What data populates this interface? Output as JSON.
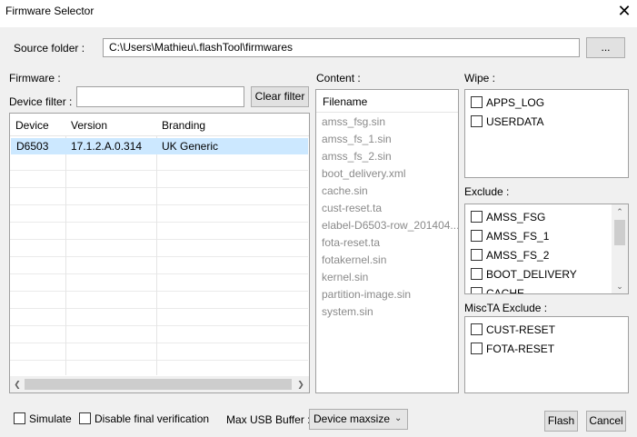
{
  "window": {
    "title": "Firmware Selector",
    "close_glyph": "✕"
  },
  "source": {
    "label": "Source folder :",
    "path": "C:\\Users\\Mathieu\\.flashTool\\firmwares",
    "browse_label": "..."
  },
  "firmware": {
    "label": "Firmware :",
    "filter_label": "Device filter :",
    "filter_value": "",
    "clear_label": "Clear filter",
    "columns": [
      "Device",
      "Version",
      "Branding"
    ],
    "rows": [
      {
        "device": "D6503",
        "version": "17.1.2.A.0.314",
        "branding": "UK Generic"
      }
    ]
  },
  "content": {
    "label": "Content :",
    "header": "Filename",
    "files": [
      "amss_fsg.sin",
      "amss_fs_1.sin",
      "amss_fs_2.sin",
      "boot_delivery.xml",
      "cache.sin",
      "cust-reset.ta",
      "elabel-D6503-row_201404...",
      "fota-reset.ta",
      "fotakernel.sin",
      "kernel.sin",
      "partition-image.sin",
      "system.sin"
    ]
  },
  "wipe": {
    "label": "Wipe :",
    "items": [
      "APPS_LOG",
      "USERDATA"
    ]
  },
  "exclude": {
    "label": "Exclude :",
    "items": [
      "AMSS_FSG",
      "AMSS_FS_1",
      "AMSS_FS_2",
      "BOOT_DELIVERY",
      "CACHE"
    ]
  },
  "miscta": {
    "label": "MiscTA Exclude :",
    "items": [
      "CUST-RESET",
      "FOTA-RESET"
    ]
  },
  "footer": {
    "simulate_label": "Simulate",
    "disable_verification_label": "Disable final verification",
    "usb_buffer_label": "Max USB Buffer :",
    "usb_buffer_value": "Device maxsize",
    "flash_label": "Flash",
    "cancel_label": "Cancel"
  },
  "colors": {
    "selection": "#cce8ff",
    "disabled_text": "#8a8a8a"
  }
}
